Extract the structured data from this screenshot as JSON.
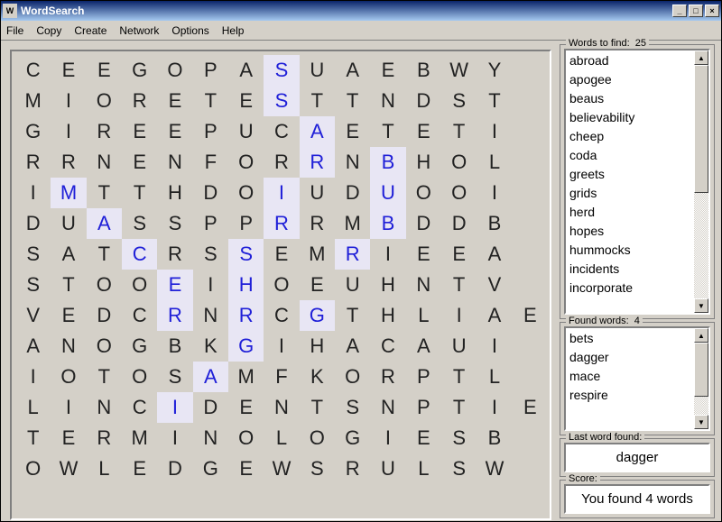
{
  "window": {
    "title": "WordSearch"
  },
  "menu": [
    "File",
    "Copy",
    "Create",
    "Network",
    "Options",
    "Help"
  ],
  "grid": {
    "rows": [
      "CEEGOPASUAEBWY ",
      "MIORETESTTNDST ",
      "GIREEPUCAETETI ",
      "RRNENFORRNBHOL ",
      "IMTTHDOIUDUOOI ",
      "DUASSPPRRMBDDB ",
      "SATCRSSEMRIEEA ",
      "STOOEIHOEUHNTV ",
      "VEDCRNRCGTHLIAE",
      "ANOGBKGIHACAUI ",
      "IOTOSAMFKORPTL ",
      "LINCIDENTSNPTIE",
      "TERMINOLOGIESB ",
      "OWLEDGEWSRULSW "
    ],
    "highlights": [
      [
        0,
        7
      ],
      [
        1,
        7
      ],
      [
        2,
        8
      ],
      [
        3,
        8
      ],
      [
        3,
        10
      ],
      [
        4,
        1
      ],
      [
        4,
        7
      ],
      [
        4,
        10
      ],
      [
        5,
        2
      ],
      [
        5,
        7
      ],
      [
        5,
        10
      ],
      [
        6,
        3
      ],
      [
        6,
        6
      ],
      [
        6,
        9
      ],
      [
        7,
        4
      ],
      [
        7,
        6
      ],
      [
        8,
        4
      ],
      [
        8,
        6
      ],
      [
        8,
        8
      ],
      [
        9,
        6
      ],
      [
        10,
        5
      ],
      [
        11,
        4
      ]
    ]
  },
  "panels": {
    "toFind": {
      "legend_prefix": "Words to find:",
      "count": 25,
      "words": [
        "abroad",
        "apogee",
        "beaus",
        "believability",
        "cheep",
        "coda",
        "greets",
        "grids",
        "herd",
        "hopes",
        "hummocks",
        "incidents",
        "incorporate"
      ]
    },
    "found": {
      "legend_prefix": "Found words:",
      "count": 4,
      "words": [
        "bets",
        "dagger",
        "mace",
        "respire"
      ]
    },
    "last": {
      "legend": "Last word found:",
      "value": "dagger"
    },
    "score": {
      "legend": "Score:",
      "value": "You found 4 words"
    }
  }
}
